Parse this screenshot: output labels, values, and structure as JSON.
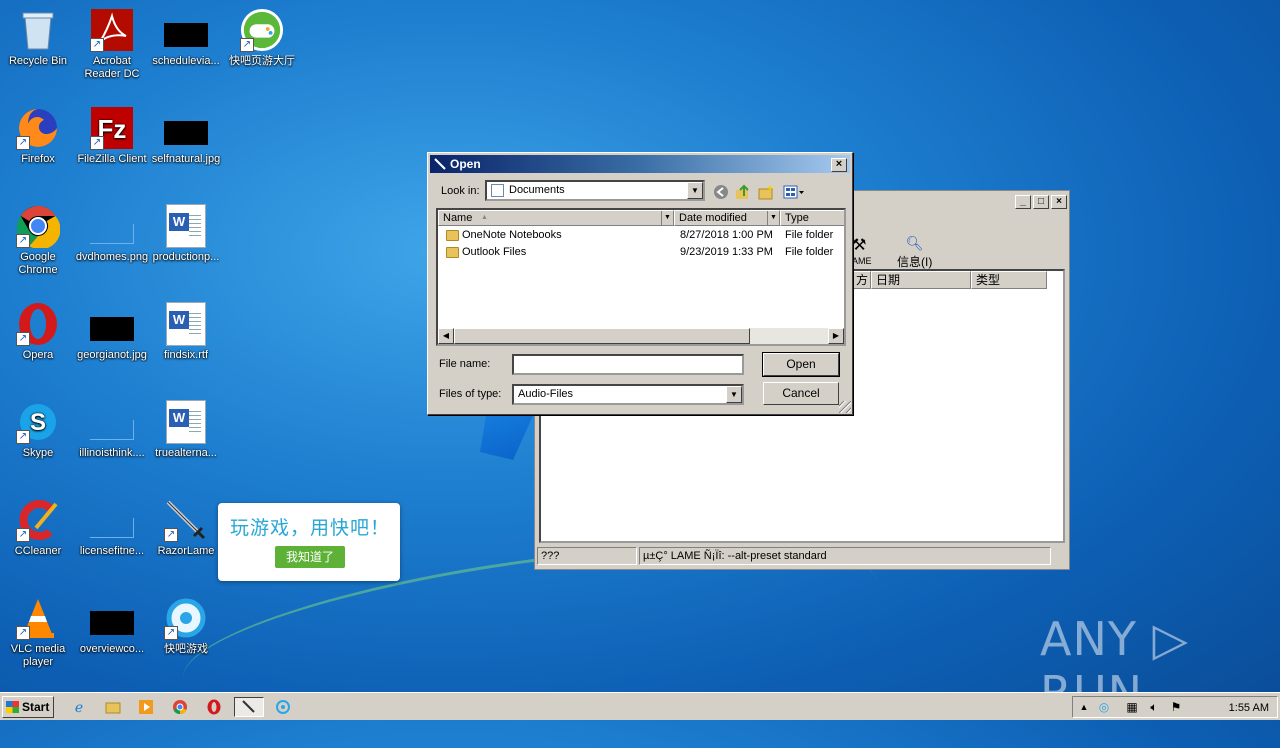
{
  "desktop": {
    "icons": [
      {
        "label": "Recycle Bin"
      },
      {
        "label": "Acrobat Reader DC"
      },
      {
        "label": "schedulevia..."
      },
      {
        "label": "快吧页游大厅"
      },
      {
        "label": "Firefox"
      },
      {
        "label": "FileZilla Client"
      },
      {
        "label": "selfnatural.jpg"
      },
      {
        "label": "Google Chrome"
      },
      {
        "label": "dvdhomes.png"
      },
      {
        "label": "productionp..."
      },
      {
        "label": "Opera"
      },
      {
        "label": "georgianot.jpg"
      },
      {
        "label": "findsix.rtf"
      },
      {
        "label": "Skype"
      },
      {
        "label": "illinoisthink...."
      },
      {
        "label": "truealterna..."
      },
      {
        "label": "CCleaner"
      },
      {
        "label": "licensefitne..."
      },
      {
        "label": "RazorLame"
      },
      {
        "label": "VLC media player"
      },
      {
        "label": "overviewco..."
      },
      {
        "label": "快吧游戏"
      }
    ],
    "promo": {
      "title": "玩游戏，用快吧！",
      "button": "我知道了"
    },
    "watermark": "ANY ▷ RUN"
  },
  "background_window": {
    "toolbar": [
      {
        "label": "LAME"
      },
      {
        "label": "信息(I)"
      }
    ],
    "columns": [
      "方",
      "日期",
      "类型"
    ],
    "status": {
      "left": "???",
      "right": "µ±Ç° LAME Ñ¡Ïî:  --alt-preset standard"
    }
  },
  "dialog": {
    "title": "Open",
    "look_in_label": "Look in:",
    "look_in_value": "Documents",
    "columns": {
      "name": "Name",
      "date": "Date modified",
      "type": "Type"
    },
    "files": [
      {
        "name": "OneNote Notebooks",
        "date": "8/27/2018 1:00 PM",
        "type": "File folder"
      },
      {
        "name": "Outlook Files",
        "date": "9/23/2019 1:33 PM",
        "type": "File folder"
      }
    ],
    "file_name_label": "File name:",
    "file_name_value": "",
    "files_of_type_label": "Files of type:",
    "files_of_type_value": "Audio-Files",
    "open_button": "Open",
    "cancel_button": "Cancel",
    "close_glyph": "×"
  },
  "taskbar": {
    "start_label": "Start",
    "clock": "1:55 AM"
  },
  "colors": {
    "accent": "#0a246a",
    "promo_green": "#5db136",
    "promo_blue": "#28a7d6"
  }
}
